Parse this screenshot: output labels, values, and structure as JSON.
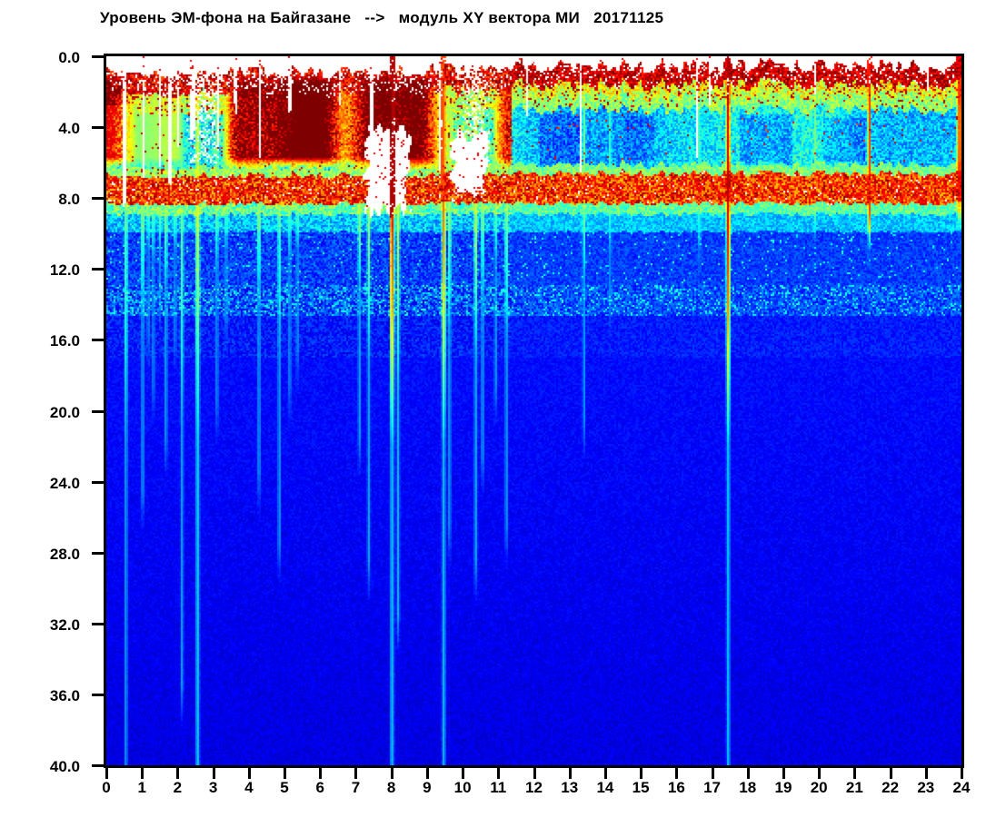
{
  "header": {
    "title": "Уровень ЭМ-фона на Байгазане   -->   модуль XY вектора МИ   20171125"
  },
  "chart_data": {
    "type": "heatmap",
    "subtype": "spectrogram",
    "title": "Уровень ЭМ-фона на Байгазане",
    "signal": "модуль XY вектора МИ",
    "date": "20171125",
    "xlabel": "",
    "ylabel": "",
    "xlim": [
      0,
      24
    ],
    "ylim": [
      0,
      40
    ],
    "y_axis_inverted": true,
    "xticks": [
      0,
      1,
      2,
      3,
      4,
      5,
      6,
      7,
      8,
      9,
      10,
      11,
      12,
      13,
      14,
      15,
      16,
      17,
      18,
      19,
      20,
      21,
      22,
      23,
      24
    ],
    "xtick_labels": [
      "0",
      "1",
      "2",
      "3",
      "4",
      "5",
      "6",
      "7",
      "8",
      "9",
      "10",
      "11",
      "12",
      "13",
      "14",
      "15",
      "16",
      "17",
      "18",
      "19",
      "20",
      "21",
      "22",
      "23",
      "24"
    ],
    "yticks": [
      0,
      4,
      8,
      12,
      16,
      20,
      24,
      28,
      32,
      36,
      40
    ],
    "ytick_labels": [
      "0.0",
      "4.0",
      "8.0",
      "12.0",
      "16.0",
      "20.0",
      "24.0",
      "28.0",
      "32.0",
      "36.0",
      "40.0"
    ],
    "colormap": "jet",
    "nodata_color": "#ffffff",
    "axis_color": "#000000",
    "value_scale": "relative intensity 0-1 (blue=low, red=high, white=no data)",
    "seed": 20171125,
    "region_split_hour": 11.35,
    "bands_steady": [
      {
        "f0": 0.0,
        "f1": 0.55,
        "v": -1
      },
      {
        "f0": 0.55,
        "f1": 1.6,
        "v": 0.93,
        "n": 0.1,
        "dp": 0.14
      },
      {
        "f0": 1.6,
        "f1": 2.2,
        "v": 0.6,
        "n": 0.12,
        "rs": 0.15
      },
      {
        "f0": 2.2,
        "f1": 3.0,
        "v": 0.52,
        "n": 0.09,
        "rs": 0.06
      },
      {
        "f0": 3.0,
        "f1": 6.1,
        "v": 0.36,
        "n": 0.1,
        "sv": 0.09,
        "rs": 0.015
      },
      {
        "f0": 6.1,
        "f1": 6.6,
        "v": 0.5,
        "n": 0.07
      },
      {
        "f0": 6.6,
        "f1": 8.3,
        "v": 0.8,
        "n": 0.13,
        "rs": 0.22,
        "dp": 0.03
      },
      {
        "f0": 8.3,
        "f1": 8.9,
        "v": 0.47,
        "n": 0.08
      },
      {
        "f0": 8.9,
        "f1": 9.9,
        "v": 0.32,
        "n": 0.07
      },
      {
        "f0": 9.9,
        "f1": 12.9,
        "v": 0.185,
        "n": 0.05,
        "cs": 0.03
      },
      {
        "f0": 12.9,
        "f1": 14.6,
        "v": 0.2,
        "n": 0.08,
        "cs": 0.12
      },
      {
        "f0": 14.6,
        "f1": 17.0,
        "v": 0.15,
        "n": 0.04
      },
      {
        "f0": 17.0,
        "f1": 40.0,
        "v": 0.135,
        "ve": 0.095,
        "n": 0.03
      }
    ],
    "bands_disturbed": [
      {
        "f0": 0.0,
        "f1": 0.8,
        "v": -1
      },
      {
        "f0": 0.8,
        "f1": 2.0,
        "v": 0.9,
        "n": 0.13,
        "dp": 0.18
      },
      {
        "f0": 2.0,
        "f1": 3.1,
        "v": 0.55,
        "n": 0.13,
        "rs": 0.12
      },
      {
        "f0": 3.1,
        "f1": 6.2,
        "v": 0.43,
        "n": 0.13,
        "sv": 0.16,
        "rs": 0.03
      },
      {
        "f0": 6.2,
        "f1": 6.7,
        "v": 0.52,
        "n": 0.09,
        "rs": 0.05
      },
      {
        "f0": 6.7,
        "f1": 8.3,
        "v": 0.8,
        "n": 0.14,
        "rs": 0.25,
        "dp": 0.05
      },
      {
        "f0": 8.3,
        "f1": 8.9,
        "v": 0.47,
        "n": 0.08
      },
      {
        "f0": 8.9,
        "f1": 9.9,
        "v": 0.32,
        "n": 0.07
      },
      {
        "f0": 9.9,
        "f1": 12.9,
        "v": 0.185,
        "n": 0.05,
        "cs": 0.03
      },
      {
        "f0": 12.9,
        "f1": 14.6,
        "v": 0.2,
        "n": 0.08,
        "cs": 0.12
      },
      {
        "f0": 14.6,
        "f1": 17.0,
        "v": 0.15,
        "n": 0.04
      },
      {
        "f0": 17.0,
        "f1": 40.0,
        "v": 0.135,
        "ve": 0.095,
        "n": 0.03
      }
    ],
    "white_gaps": [
      {
        "h": 0.52,
        "w": 0.045,
        "fmax": 8.4
      },
      {
        "h": 1.05,
        "w": 0.022,
        "fmax": 6.8
      },
      {
        "h": 1.52,
        "w": 0.02,
        "fmax": 6.4
      },
      {
        "h": 1.78,
        "w": 0.022,
        "fmax": 7.0
      },
      {
        "h": 2.03,
        "w": 0.02,
        "fmax": 5.2
      },
      {
        "h": 2.42,
        "w": 0.075,
        "fmax": 4.3
      },
      {
        "h": 3.13,
        "w": 0.02,
        "fmax": 5.0
      },
      {
        "h": 3.62,
        "w": 0.018,
        "fmax": 3.2
      },
      {
        "h": 4.3,
        "w": 0.022,
        "fmax": 5.6
      },
      {
        "h": 5.15,
        "w": 0.03,
        "fmax": 3.1
      },
      {
        "h": 6.55,
        "w": 0.018,
        "fmax": 2.6
      },
      {
        "h": 7.44,
        "w": 0.04,
        "fmax": 8.6
      },
      {
        "h": 8.06,
        "w": 0.032,
        "fmax": 8.7
      },
      {
        "h": 9.4,
        "w": 0.04,
        "fmax": 6.9
      },
      {
        "h": 11.8,
        "w": 0.016,
        "fmax": 3.6
      },
      {
        "h": 13.34,
        "w": 0.016,
        "fmax": 6.6
      },
      {
        "h": 16.6,
        "w": 0.016,
        "fmax": 6.2
      },
      {
        "h": 16.95,
        "w": 0.014,
        "fmax": 3.0
      },
      {
        "h": 17.45,
        "w": 0.028,
        "fmax": 2.3
      },
      {
        "h": 19.88,
        "w": 0.016,
        "fmax": 2.1
      },
      {
        "h": 21.4,
        "w": 0.02,
        "fmax": 1.9
      },
      {
        "h": 23.05,
        "w": 0.014,
        "fmax": 2.2
      }
    ],
    "streaks": [
      {
        "h": 0.55,
        "w": 0.035,
        "fend": 40,
        "vt": 0.5,
        "vb": 0.3
      },
      {
        "h": 1.02,
        "w": 0.03,
        "fend": 27,
        "vt": 0.55,
        "vb": 0.3
      },
      {
        "h": 1.18,
        "w": 0.025,
        "fend": 18,
        "vt": 0.5,
        "vb": 0.28
      },
      {
        "h": 1.32,
        "w": 0.025,
        "fend": 21,
        "vt": 0.5,
        "vb": 0.28
      },
      {
        "h": 1.5,
        "w": 0.025,
        "fend": 16,
        "vt": 0.5,
        "vb": 0.28
      },
      {
        "h": 1.67,
        "w": 0.03,
        "fend": 24,
        "vt": 0.55,
        "vb": 0.3
      },
      {
        "h": 1.93,
        "w": 0.025,
        "fend": 18,
        "vt": 0.5,
        "vb": 0.28
      },
      {
        "h": 2.12,
        "w": 0.03,
        "fend": 38,
        "vt": 0.5,
        "vb": 0.3
      },
      {
        "h": 2.56,
        "w": 0.045,
        "fend": 40,
        "vt": 0.62,
        "vb": 0.36
      },
      {
        "h": 3.1,
        "w": 0.03,
        "fend": 22,
        "vt": 0.5,
        "vb": 0.28
      },
      {
        "h": 3.36,
        "w": 0.025,
        "fend": 17,
        "vt": 0.5,
        "vb": 0.28
      },
      {
        "h": 4.28,
        "w": 0.03,
        "fend": 26,
        "vt": 0.55,
        "vb": 0.3
      },
      {
        "h": 4.85,
        "w": 0.03,
        "fend": 30,
        "vt": 0.5,
        "vb": 0.3
      },
      {
        "h": 5.14,
        "w": 0.03,
        "fend": 21,
        "vt": 0.5,
        "vb": 0.28
      },
      {
        "h": 5.36,
        "w": 0.025,
        "fend": 19,
        "vt": 0.5,
        "vb": 0.28
      },
      {
        "h": 7.1,
        "w": 0.03,
        "fend": 24,
        "vt": 0.55,
        "vb": 0.3
      },
      {
        "h": 7.36,
        "w": 0.03,
        "fend": 31,
        "vt": 0.55,
        "vb": 0.3
      },
      {
        "h": 8.01,
        "w": 0.05,
        "fend": 40,
        "vt": 0.95,
        "vb": 0.34
      },
      {
        "h": 8.18,
        "w": 0.03,
        "fend": 34,
        "vt": 0.6,
        "vb": 0.32
      },
      {
        "h": 9.46,
        "w": 0.04,
        "fend": 40,
        "vt": 0.8,
        "vb": 0.33
      },
      {
        "h": 9.62,
        "w": 0.03,
        "fend": 29,
        "vt": 0.55,
        "vb": 0.3
      },
      {
        "h": 10.36,
        "w": 0.035,
        "fend": 31,
        "vt": 0.6,
        "vb": 0.31
      },
      {
        "h": 10.55,
        "w": 0.03,
        "fend": 25,
        "vt": 0.55,
        "vb": 0.3
      },
      {
        "h": 10.92,
        "w": 0.03,
        "fend": 21,
        "vt": 0.5,
        "vb": 0.29
      },
      {
        "h": 11.22,
        "w": 0.03,
        "fend": 29,
        "vt": 0.55,
        "vb": 0.3
      },
      {
        "h": 13.42,
        "w": 0.025,
        "fend": 23,
        "vt": 0.5,
        "vb": 0.29
      },
      {
        "h": 14.15,
        "w": 0.02,
        "fend": 16,
        "vt": 0.45,
        "vb": 0.27
      },
      {
        "h": 16.65,
        "w": 0.02,
        "fend": 13,
        "vt": 0.45,
        "vb": 0.27
      },
      {
        "h": 17.46,
        "w": 0.04,
        "fend": 40,
        "vt": 0.95,
        "vb": 0.34
      },
      {
        "h": 19.9,
        "w": 0.02,
        "fend": 11,
        "vt": 0.5,
        "vb": 0.28
      },
      {
        "h": 21.42,
        "w": 0.03,
        "fend": 12,
        "vt": 0.85,
        "vb": 0.3
      },
      {
        "h": 23.95,
        "w": 0.07,
        "fend": 10,
        "vt": 0.88,
        "vb": 0.45
      }
    ],
    "white_patches": [
      {
        "h0": 7.3,
        "h1": 8.45,
        "f0": 4.2,
        "f1": 8.6
      },
      {
        "h0": 9.7,
        "h1": 10.62,
        "f0": 4.4,
        "f1": 7.9
      }
    ],
    "cold_patches": [
      {
        "h0": -0.1,
        "h1": 0.62,
        "f0": 2.8,
        "f1": 6.3,
        "dv": -0.1
      },
      {
        "h0": 12.2,
        "h1": 13.3,
        "f0": 3.3,
        "f1": 6.0,
        "dv": -0.07
      },
      {
        "h0": 14.5,
        "h1": 15.4,
        "f0": 3.4,
        "f1": 5.9,
        "dv": -0.05
      },
      {
        "h0": 17.8,
        "h1": 19.25,
        "f0": 3.3,
        "f1": 6.1,
        "dv": -0.09
      },
      {
        "h0": 20.15,
        "h1": 21.3,
        "f0": 3.5,
        "f1": 5.9,
        "dv": -0.07
      }
    ]
  }
}
